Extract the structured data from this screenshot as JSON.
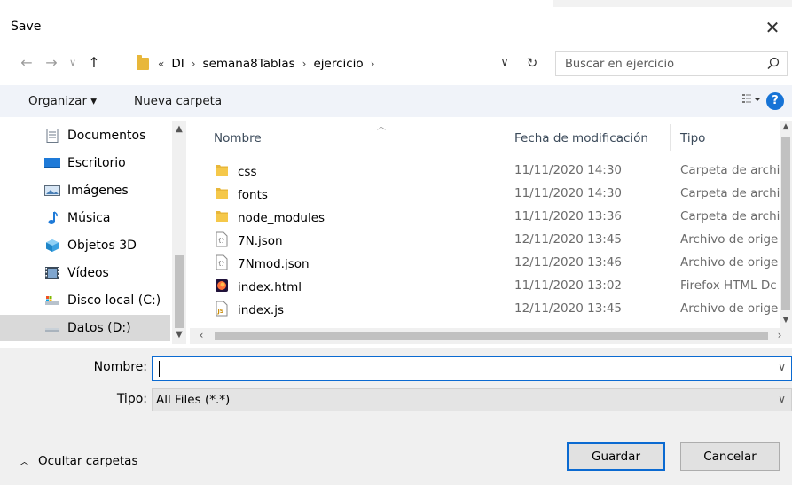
{
  "window": {
    "title": "Save"
  },
  "address": {
    "overflow": "«",
    "crumbs": [
      "DI",
      "semana8Tablas",
      "ejercicio"
    ],
    "search_placeholder": "Buscar en ejercicio"
  },
  "toolbar": {
    "organize": "Organizar ▾",
    "new_folder": "Nueva carpeta"
  },
  "sidebar": {
    "items": [
      {
        "label": "Documentos",
        "icon": "documents-icon"
      },
      {
        "label": "Escritorio",
        "icon": "desktop-icon"
      },
      {
        "label": "Imágenes",
        "icon": "pictures-icon"
      },
      {
        "label": "Música",
        "icon": "music-icon"
      },
      {
        "label": "Objetos 3D",
        "icon": "3d-objects-icon"
      },
      {
        "label": "Vídeos",
        "icon": "videos-icon"
      },
      {
        "label": "Disco local (C:)",
        "icon": "local-disk-icon"
      },
      {
        "label": "Datos (D:)",
        "icon": "drive-icon",
        "selected": true
      }
    ]
  },
  "list": {
    "columns": [
      "Nombre",
      "Fecha de modificación",
      "Tipo"
    ],
    "rows": [
      {
        "name": "css",
        "date": "11/11/2020 14:30",
        "type": "Carpeta de archi",
        "icon": "folder-icon"
      },
      {
        "name": "fonts",
        "date": "11/11/2020 14:30",
        "type": "Carpeta de archi",
        "icon": "folder-icon"
      },
      {
        "name": "node_modules",
        "date": "11/11/2020 13:36",
        "type": "Carpeta de archi",
        "icon": "folder-icon"
      },
      {
        "name": "7N.json",
        "date": "12/11/2020 13:45",
        "type": "Archivo de orige",
        "icon": "json-file-icon"
      },
      {
        "name": "7Nmod.json",
        "date": "12/11/2020 13:46",
        "type": "Archivo de orige",
        "icon": "json-file-icon"
      },
      {
        "name": "index.html",
        "date": "11/11/2020 13:02",
        "type": "Firefox HTML Dc",
        "icon": "firefox-html-icon"
      },
      {
        "name": "index.js",
        "date": "12/11/2020 13:45",
        "type": "Archivo de orige",
        "icon": "js-file-icon"
      }
    ]
  },
  "form": {
    "name_label": "Nombre:",
    "name_value": "",
    "type_label": "Tipo:",
    "type_value": "All Files (*.*)"
  },
  "footer": {
    "hide_folders": "Ocultar carpetas",
    "save": "Guardar",
    "cancel": "Cancelar"
  },
  "colors": {
    "accent": "#0b6ad1",
    "help": "#1673d6",
    "folder": "#e8b73a",
    "toolbar_bg": "#f0f3f9"
  }
}
